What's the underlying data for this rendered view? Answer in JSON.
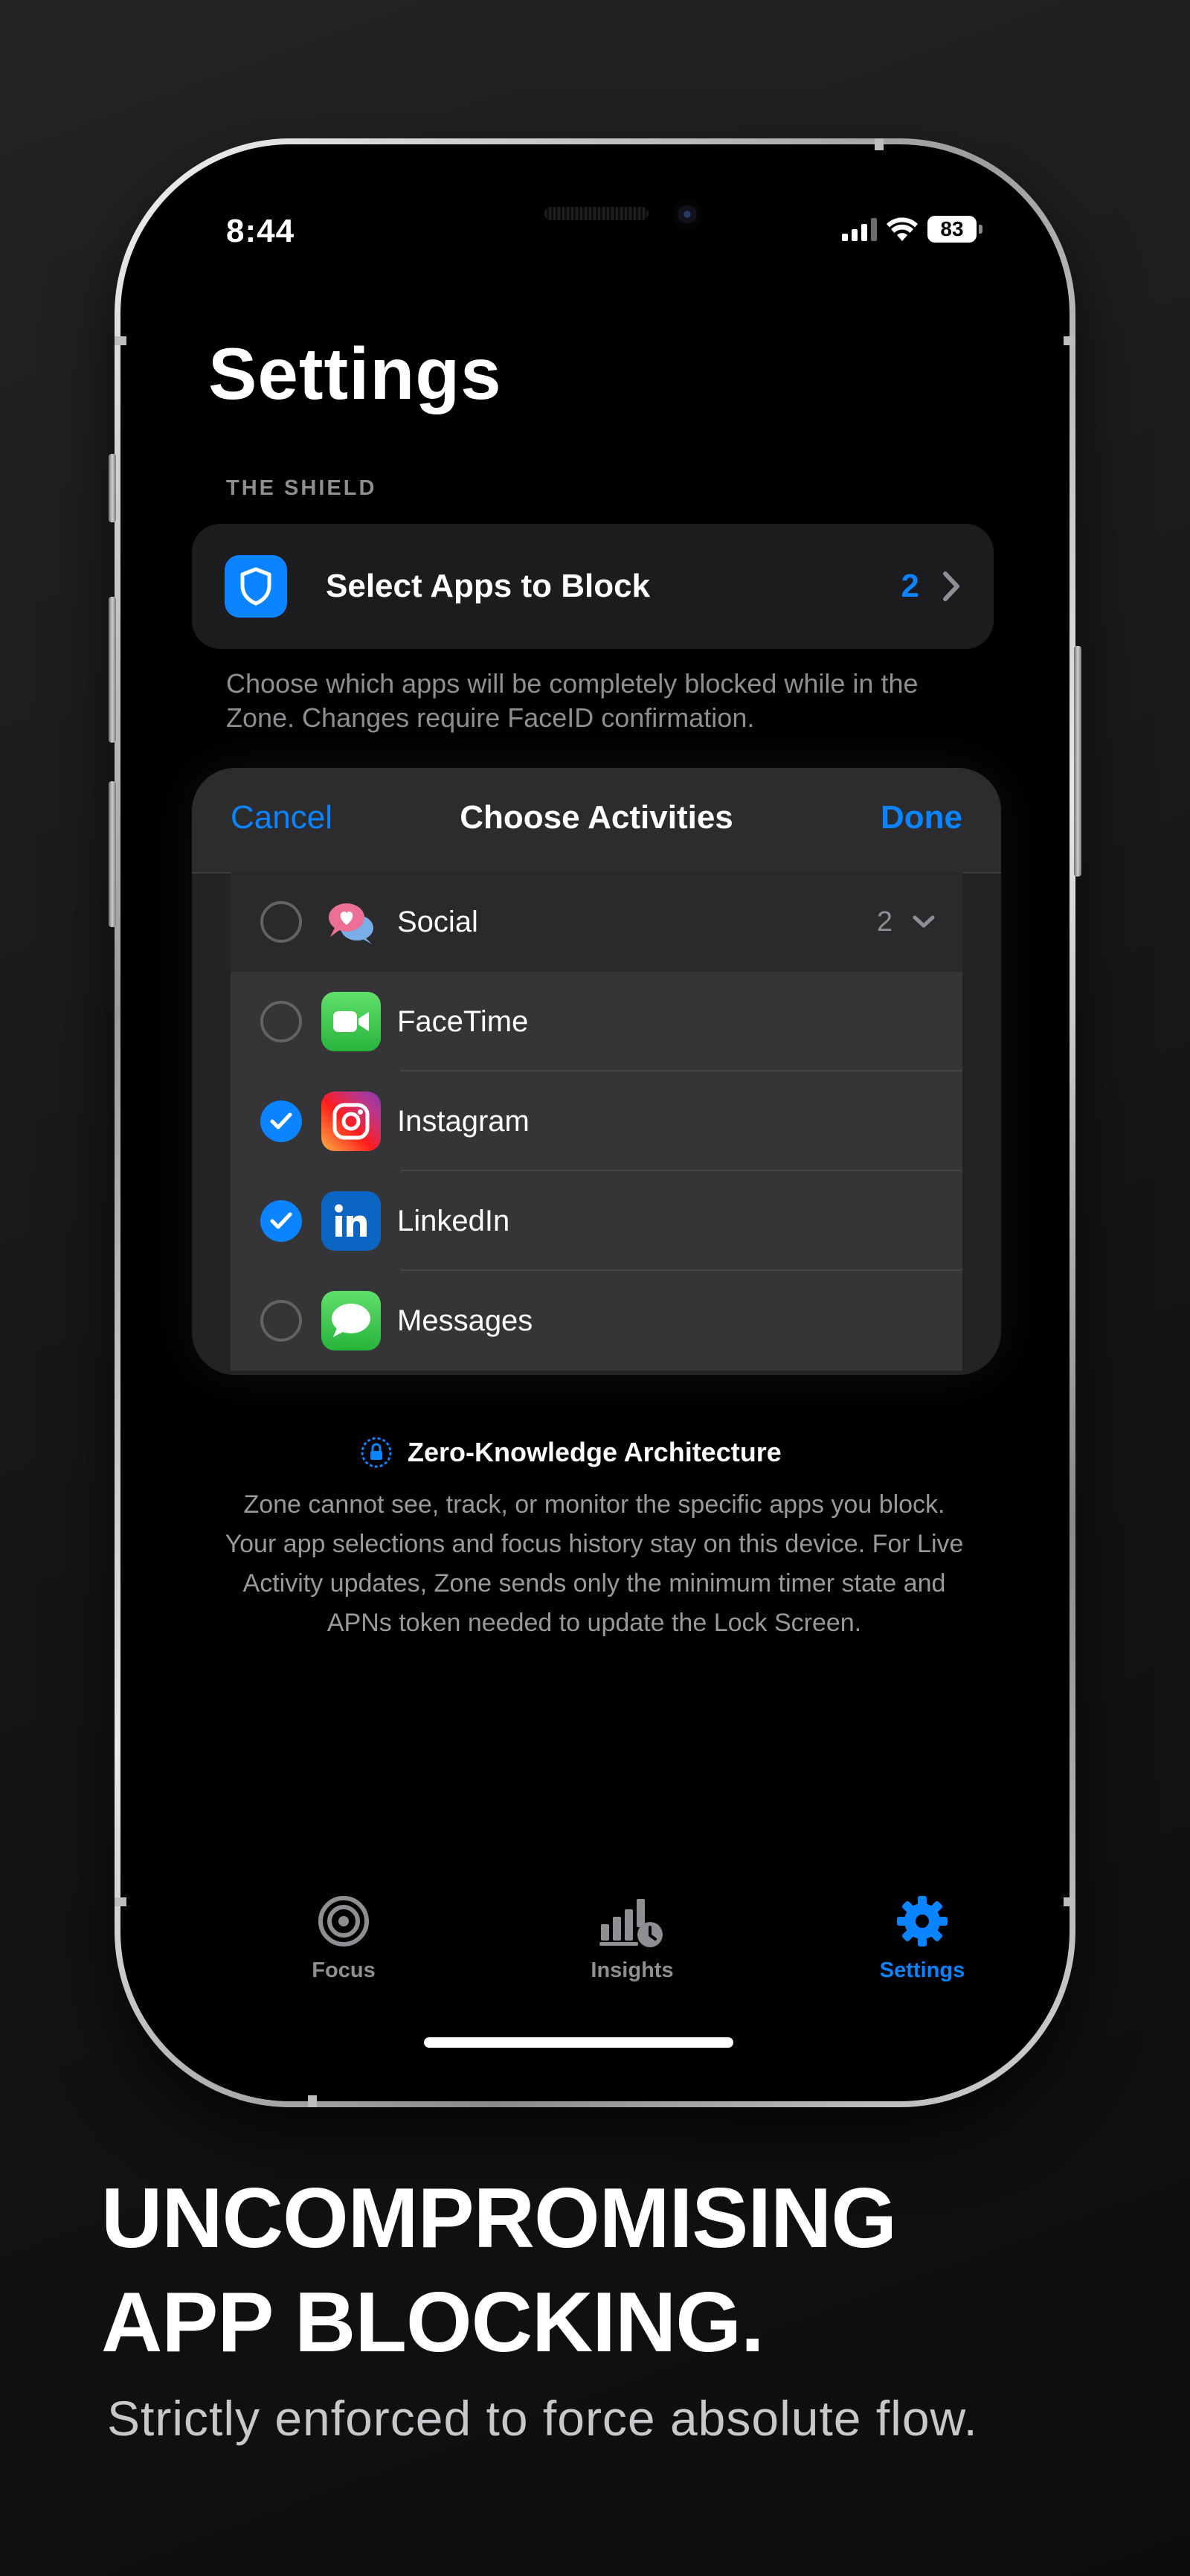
{
  "status_bar": {
    "time": "8:44",
    "battery": "83"
  },
  "page": {
    "title": "Settings"
  },
  "shield_section": {
    "header": "THE SHIELD",
    "row_label": "Select Apps to Block",
    "row_count": "2",
    "footer": "Choose which apps will be completely blocked while in the Zone. Changes require FaceID confirmation."
  },
  "sheet": {
    "cancel": "Cancel",
    "title": "Choose Activities",
    "done": "Done",
    "category": {
      "label": "Social",
      "count": "2",
      "selected": false,
      "icon": "social-bubbles-icon"
    },
    "apps": [
      {
        "label": "FaceTime",
        "selected": false,
        "icon": "facetime-icon",
        "color": "#34c759"
      },
      {
        "label": "Instagram",
        "selected": true,
        "icon": "instagram-icon",
        "color": "#e1306c"
      },
      {
        "label": "LinkedIn",
        "selected": true,
        "icon": "linkedin-icon",
        "color": "#0a66c2"
      },
      {
        "label": "Messages",
        "selected": false,
        "icon": "messages-icon",
        "color": "#34c759"
      }
    ]
  },
  "privacy": {
    "title": "Zero-Knowledge Architecture",
    "body": "Zone cannot see, track, or monitor the specific apps you block. Your app selections and focus history stay on this device. For Live Activity updates, Zone sends only the minimum timer state and APNs token needed to update the Lock Screen."
  },
  "tab_bar": {
    "tabs": [
      {
        "label": "Focus",
        "icon": "target-icon",
        "active": false
      },
      {
        "label": "Insights",
        "icon": "chart-clock-icon",
        "active": false
      },
      {
        "label": "Settings",
        "icon": "gear-icon",
        "active": true
      }
    ]
  },
  "marketing": {
    "headline_line1": "UNCOMPROMISING",
    "headline_line2": "APP BLOCKING.",
    "subline": "Strictly enforced to force absolute flow."
  },
  "colors": {
    "accent": "#0a84ff",
    "background": "#000000",
    "card": "#1c1c1e"
  }
}
